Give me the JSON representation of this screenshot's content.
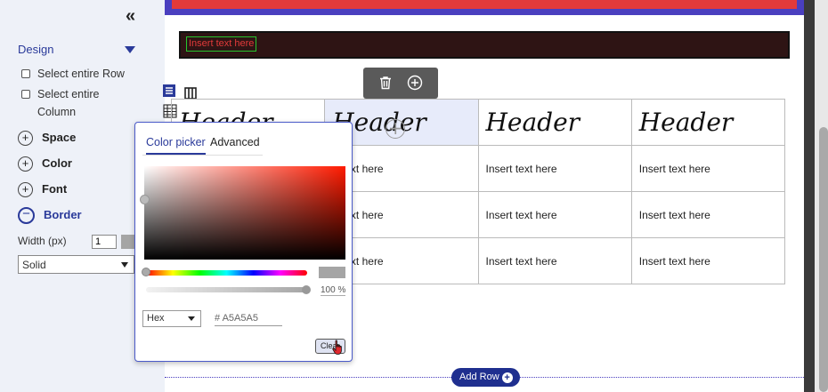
{
  "sidebar": {
    "collapse_glyph": "«",
    "design_title": "Design",
    "select_row": "Select entire Row",
    "select_column_1": "Select entire",
    "select_column_2": "Column",
    "sections": [
      {
        "label": "Space",
        "symbol": "+"
      },
      {
        "label": "Color",
        "symbol": "+"
      },
      {
        "label": "Font",
        "symbol": "+"
      },
      {
        "label": "Border",
        "symbol": "−"
      }
    ],
    "width_label": "Width (px)",
    "width_value": "1",
    "border_style": "Solid",
    "swatch_color": "#A5A5A5"
  },
  "canvas": {
    "placeholder_text": "Insert text here",
    "table": {
      "header": [
        "Header",
        "Header",
        "Header",
        "Header"
      ],
      "rows": [
        [
          "",
          "rt text here",
          "Insert text here",
          "Insert text here"
        ],
        [
          "",
          "rt text here",
          "Insert text here",
          "Insert text here"
        ],
        [
          "",
          "rt text here",
          "Insert text here",
          "Insert text here"
        ]
      ]
    },
    "add_row_label": "Add Row"
  },
  "picker": {
    "tabs": [
      "Color picker",
      "Advanced"
    ],
    "alpha_value": "100 %",
    "format": "Hex",
    "hex_value": "# A5A5A5",
    "clear_label": "Clear"
  },
  "icons": {
    "collapse": "double-chevron-left-icon",
    "trash": "trash-icon",
    "add": "plus-circle-icon",
    "cursor": "hand-pointer-icon"
  },
  "colors": {
    "accent": "#2A3A9A",
    "selected_color": "#A5A5A5",
    "topbar": "#4A3FBF",
    "banner_red": "#E23A3A"
  }
}
